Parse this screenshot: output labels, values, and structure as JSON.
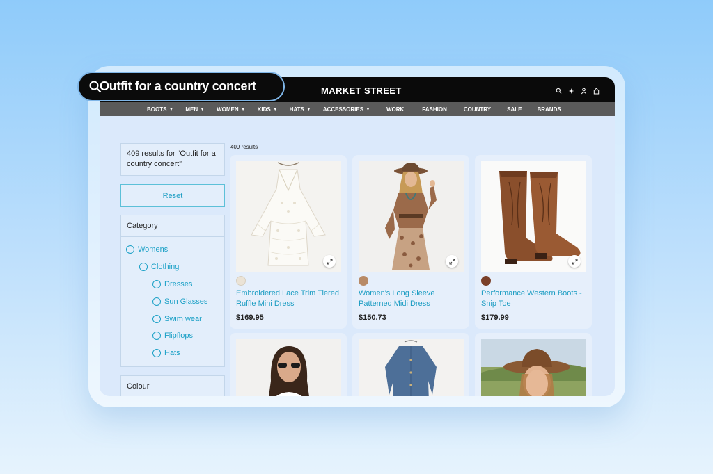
{
  "search": {
    "query": "Outfit for a country concert"
  },
  "header": {
    "brand": "MARKET STREET",
    "icons": [
      "search-icon",
      "sparkle-icon",
      "user-icon",
      "bag-icon"
    ]
  },
  "nav": {
    "items": [
      {
        "label": "BOOTS",
        "dropdown": true
      },
      {
        "label": "MEN",
        "dropdown": true
      },
      {
        "label": "WOMEN",
        "dropdown": true
      },
      {
        "label": "KIDS",
        "dropdown": true
      },
      {
        "label": "HATS",
        "dropdown": true
      },
      {
        "label": "ACCESSORIES",
        "dropdown": true
      },
      {
        "label": "WORK",
        "dropdown": false
      },
      {
        "label": "FASHION",
        "dropdown": false
      },
      {
        "label": "COUNTRY",
        "dropdown": false
      },
      {
        "label": "SALE",
        "dropdown": false
      },
      {
        "label": "BRANDS",
        "dropdown": false
      }
    ]
  },
  "sidebar": {
    "results_text": "409 results for “Outfit for a country concert”",
    "reset_label": "Reset",
    "category_heading": "Category",
    "categories": [
      {
        "label": "Womens",
        "level": 0
      },
      {
        "label": "Clothing",
        "level": 1
      },
      {
        "label": "Dresses",
        "level": 2
      },
      {
        "label": "Sun Glasses",
        "level": 2
      },
      {
        "label": "Swim wear",
        "level": 2
      },
      {
        "label": "Flipflops",
        "level": 2
      },
      {
        "label": "Hats",
        "level": 2
      }
    ],
    "colour_heading": "Colour"
  },
  "results": {
    "count_label": "409 results",
    "products": [
      {
        "title": "Embroidered Lace Trim Tiered Ruffle Mini Dress",
        "price": "$169.95",
        "swatch": "#ebe3d6"
      },
      {
        "title": "Women's Long Sleeve Patterned Midi Dress",
        "price": "$150.73",
        "swatch": "#b88a66"
      },
      {
        "title": "Performance Western Boots - Snip Toe",
        "price": "$179.99",
        "swatch": "#7a4029"
      }
    ]
  },
  "colors": {
    "accent": "#1aa0c6",
    "topbar": "#0a0a0a",
    "navbar": "#5a5a5a"
  }
}
